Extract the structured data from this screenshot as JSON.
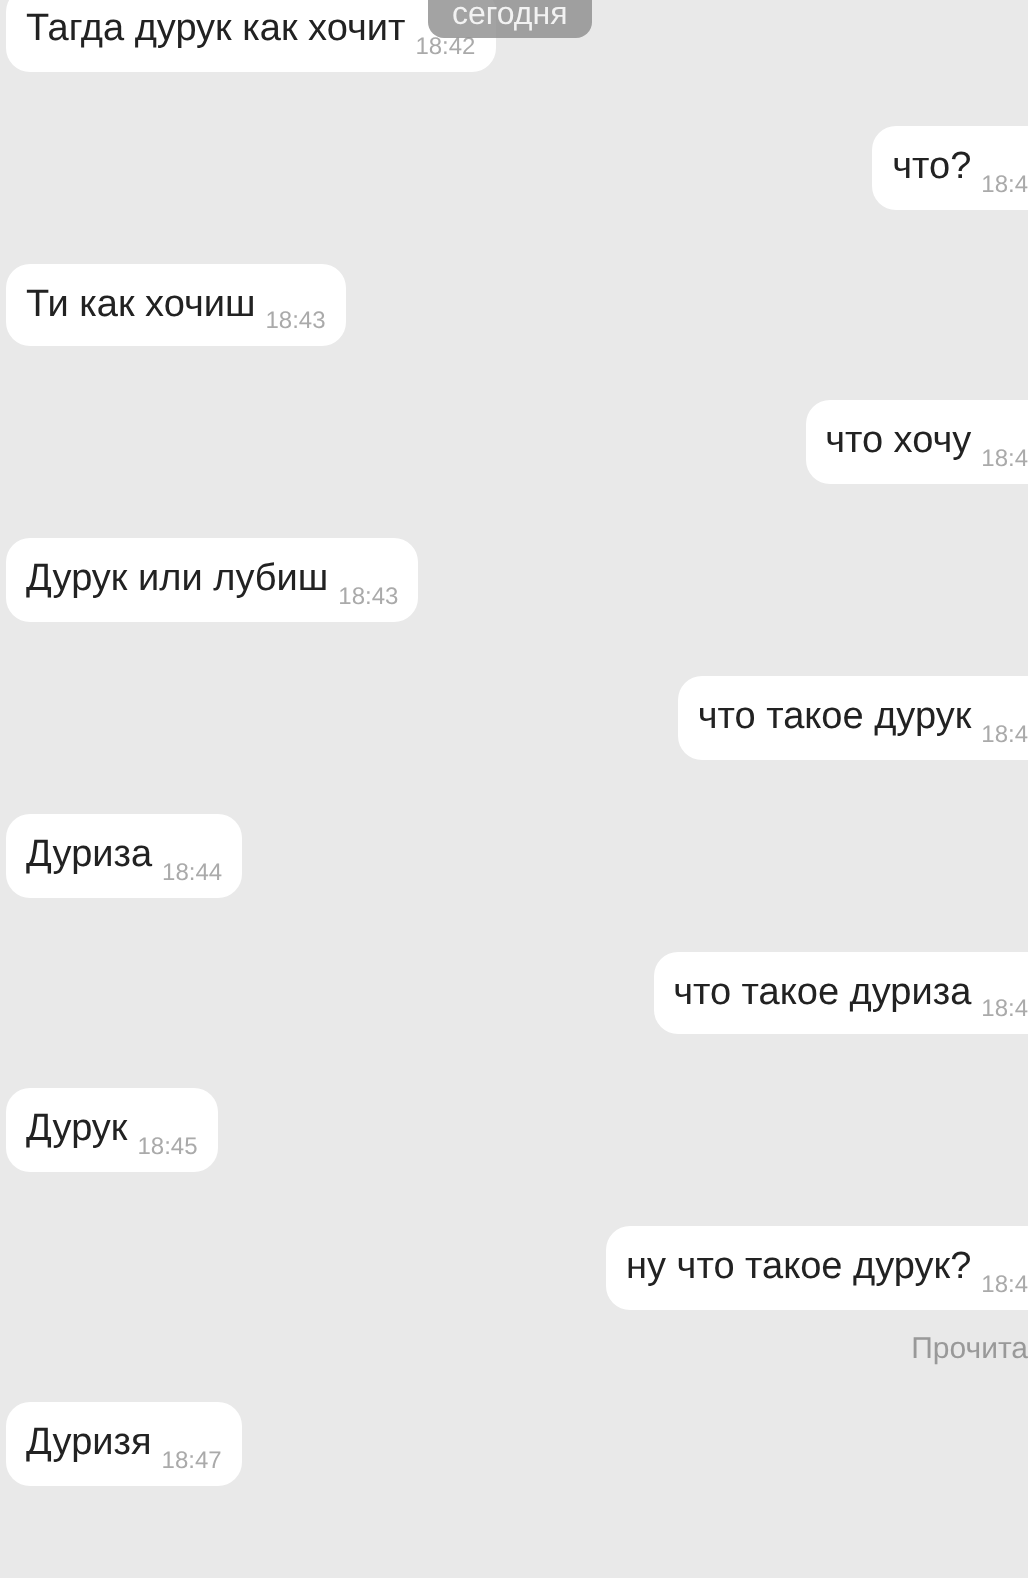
{
  "date_label": "сегодня",
  "messages": [
    {
      "kind": "incoming",
      "text": "Тагда дурук как хочит",
      "time": "18:42"
    },
    {
      "kind": "outgoing",
      "text": "что?",
      "time": "18:4"
    },
    {
      "kind": "incoming",
      "text": "Ти как хочиш",
      "time": "18:43"
    },
    {
      "kind": "outgoing",
      "text": "что хочу",
      "time": "18:4"
    },
    {
      "kind": "incoming",
      "text": "Дурук или лубиш",
      "time": "18:43"
    },
    {
      "kind": "outgoing",
      "text": "что такое дурук",
      "time": "18:4"
    },
    {
      "kind": "incoming",
      "text": "Дуриза",
      "time": "18:44"
    },
    {
      "kind": "outgoing",
      "text": "что такое дуриза",
      "time": "18:4"
    },
    {
      "kind": "incoming",
      "text": "Дурук",
      "time": "18:45"
    },
    {
      "kind": "outgoing",
      "text": "ну что такое дурук?",
      "time": "18:4"
    },
    {
      "kind": "status",
      "text": "Прочита"
    },
    {
      "kind": "incoming",
      "text": "Дуризя",
      "time": "18:47"
    }
  ]
}
